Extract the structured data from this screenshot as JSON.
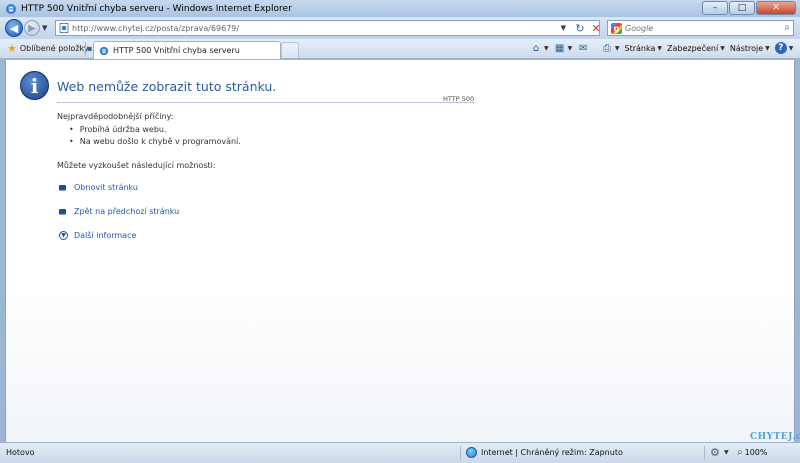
{
  "window": {
    "title": "HTTP 500 Vnitřní chyba serveru - Windows Internet Explorer",
    "minimize": "–",
    "maximize": "□",
    "close": "✕"
  },
  "nav": {
    "back": "◀",
    "forward": "▶",
    "address": "http://www.chytej.cz/posta/zprava/69679/",
    "refresh": "↻",
    "stop": "✕",
    "search_placeholder": "Google",
    "search_icon": "⌕"
  },
  "tabs": {
    "favorites": "Oblíbené položky",
    "active_tab": "HTTP 500 Vnitřní chyba serveru"
  },
  "commands": {
    "home_icon": "⌂",
    "feeds_icon": "▦",
    "mail_icon": "✉",
    "print_icon": "⎙",
    "page": "Stránka",
    "safety": "Zabezpečení",
    "tools": "Nástroje",
    "help": "?"
  },
  "content": {
    "info_icon": "i",
    "title": "Web nemůže zobrazit tuto stránku.",
    "code": "HTTP 500",
    "causes_heading": "Nejpravděpodobnější příčiny:",
    "causes": [
      "Probíhá údržba webu.",
      "Na webu došlo k chybě v programování."
    ],
    "options_heading": "Můžete vyzkoušet následující možnosti:",
    "options": [
      "Obnovit stránku",
      "Zpět na předchozí stránku"
    ],
    "more_info": "Další informace"
  },
  "status": {
    "text": "Hotovo",
    "zone": "Internet | Chráněný režim: Zapnuto",
    "zoom": "100%",
    "logo": "CHYTEJ.cz"
  }
}
